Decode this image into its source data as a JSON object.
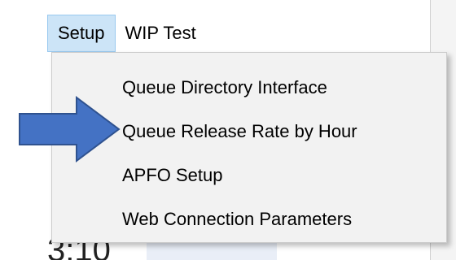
{
  "menubar": {
    "items": [
      {
        "label": "Setup",
        "active": true
      },
      {
        "label": "WIP Test",
        "active": false
      }
    ]
  },
  "dropdown": {
    "items": [
      {
        "label": "Queue Directory Interface"
      },
      {
        "label": "Queue Release Rate by Hour"
      },
      {
        "label": "APFO Setup"
      },
      {
        "label": "Web Connection Parameters"
      }
    ]
  },
  "background": {
    "partial_text": "3:10"
  },
  "colors": {
    "menu_active_bg": "#cce4f7",
    "dropdown_bg": "#f2f2f2",
    "arrow_fill": "#4472c4",
    "arrow_stroke": "#2f528f"
  },
  "annotation": {
    "icon": "right-arrow-icon"
  }
}
